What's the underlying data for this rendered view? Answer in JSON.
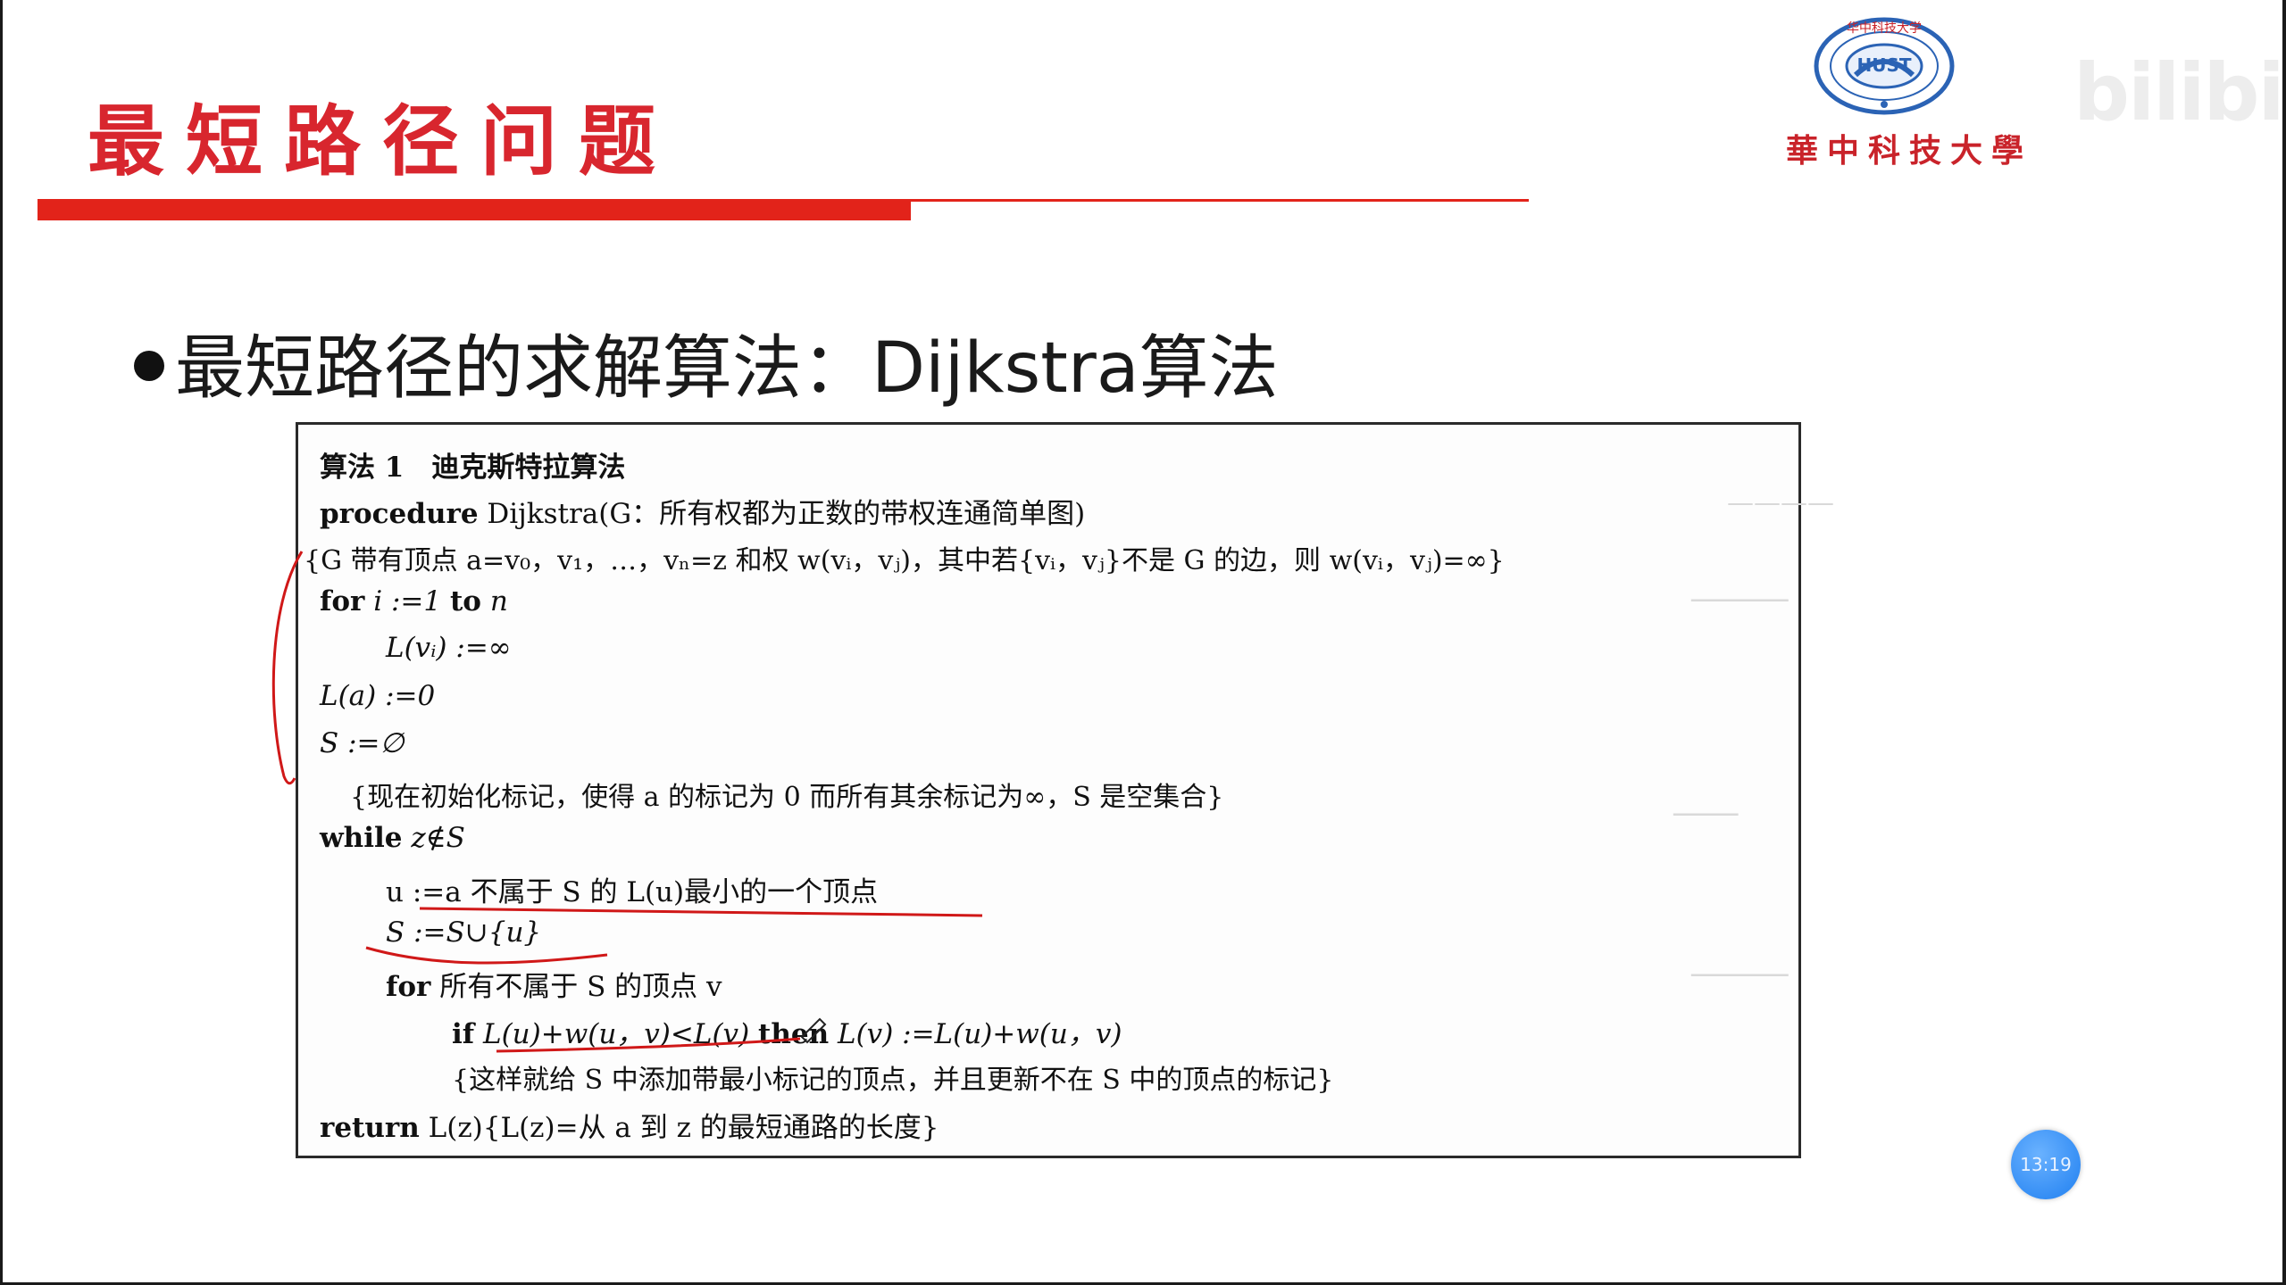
{
  "slide": {
    "title": "最短路径问题",
    "heading": "最短路径的求解算法：Dijkstra算法"
  },
  "logo": {
    "university": "華中科技大學",
    "seal_text": "华中科技大学",
    "seal_center": "HUST",
    "colors": {
      "red": "#c9232a",
      "blue": "#2b63b5"
    }
  },
  "watermark": {
    "text": "bilibili"
  },
  "time_badge": {
    "text": "13:19"
  },
  "algorithm": {
    "lines": [
      {
        "id": "header",
        "text": "算法 1　迪克斯特拉算法"
      },
      {
        "id": "procedure",
        "kw": "procedure",
        "text": " Dijkstra(G：所有权都为正数的带权连通简单图)"
      },
      {
        "id": "comment1",
        "text": "{G 带有顶点 a=v₀，v₁，…，vₙ=z 和权 w(vᵢ，vⱼ)，其中若{vᵢ，vⱼ}不是 G 的边，则 w(vᵢ，vⱼ)=∞}"
      },
      {
        "id": "for1",
        "kw": "for",
        "text": " i :=1 ",
        "kw2": "to",
        "text2": " n"
      },
      {
        "id": "init-l",
        "text": "L(vᵢ) :=∞"
      },
      {
        "id": "init-la",
        "text": "L(a) :=0"
      },
      {
        "id": "init-s",
        "text": "S :=∅"
      },
      {
        "id": "comment2",
        "text": "{现在初始化标记，使得 a 的标记为 0 而所有其余标记为∞，S 是空集合}"
      },
      {
        "id": "while",
        "kw": "while",
        "text": " z∉S"
      },
      {
        "id": "choose-u",
        "text": "u :=a 不属于 S 的 L(u)最小的一个顶点"
      },
      {
        "id": "add-u",
        "text": "S :=S∪{u}"
      },
      {
        "id": "for2",
        "kw": "for",
        "text": " 所有不属于 S 的顶点 v"
      },
      {
        "id": "if",
        "kw": "if",
        "text": " L(u)+w(u，v)<L(v) ",
        "kw2": "then",
        "text2": " L(v) :=L(u)+w(u，v)"
      },
      {
        "id": "comment3",
        "text": "{这样就给 S 中添加带最小标记的顶点，并且更新不在 S 中的顶点的标记}"
      },
      {
        "id": "return",
        "kw": "return",
        "text": " L(z){L(z)=从 a 到 z 的最短通路的长度}"
      }
    ]
  }
}
